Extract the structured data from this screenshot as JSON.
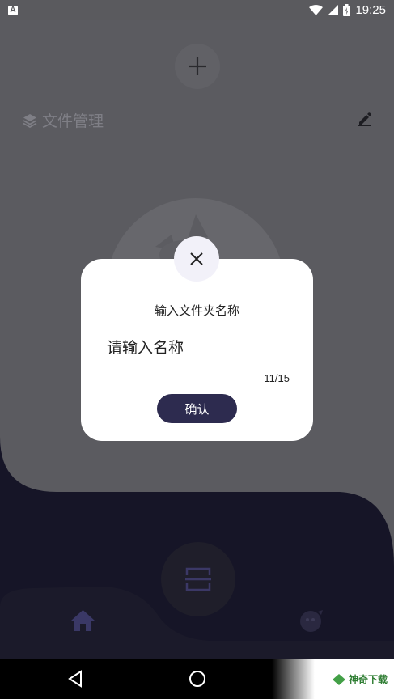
{
  "status_bar": {
    "time": "19:25"
  },
  "header": {
    "add_icon": "plus-icon"
  },
  "section": {
    "title": "文件管理",
    "icon": "layers-icon",
    "edit_icon": "pencil-icon"
  },
  "dialog": {
    "title": "输入文件夹名称",
    "input_placeholder": "请输入名称",
    "char_count": "11/15",
    "confirm_label": "确认",
    "close_icon": "close-icon"
  },
  "bottom_nav": {
    "home_icon": "home-icon",
    "scan_icon": "scan-icon",
    "profile_icon": "profile-icon"
  },
  "watermark": {
    "text": "神奇下载"
  },
  "colors": {
    "dialog_button": "#2d2b4f",
    "dark_area": "#161527",
    "overlay": "#5b5b60"
  }
}
